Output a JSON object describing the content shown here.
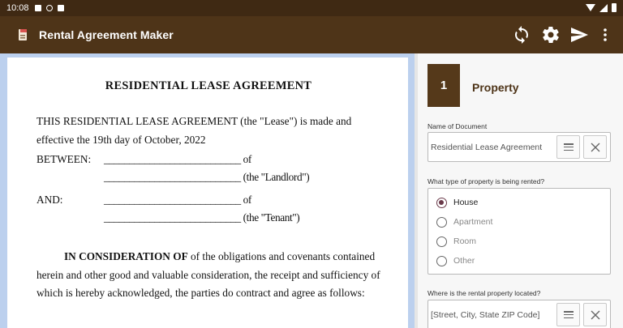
{
  "status_bar": {
    "time": "10:08",
    "icons": [
      "notification-icon",
      "debug-icon",
      "sd-card-icon",
      "wifi-icon",
      "cell-signal-icon",
      "battery-icon"
    ]
  },
  "app_bar": {
    "title": "Rental Agreement Maker",
    "background": "#4e3418",
    "actions": [
      "refresh-icon",
      "settings-icon",
      "send-icon",
      "more-vert-icon"
    ]
  },
  "document": {
    "title": "RESIDENTIAL LEASE AGREEMENT",
    "intro": "THIS RESIDENTIAL LEASE AGREEMENT (the \"Lease\") is made and effective the 19th day of October, 2022",
    "between_label": "BETWEEN:",
    "between_line1": "___________________________ of",
    "between_line2": "___________________________ (the \"Landlord\")",
    "and_label": "AND:",
    "and_line1": "___________________________ of",
    "and_line2": "___________________________ (the \"Tenant\")",
    "consideration_bold": "IN CONSIDERATION OF",
    "consideration_text": " of the obligations and covenants contained herein and other good and valuable consideration, the receipt and sufficiency of which is hereby acknowledged, the parties do contract and agree as follows:"
  },
  "panel": {
    "step_number": "1",
    "step_title": "Property",
    "doc_name": {
      "label": "Name of Document",
      "value": "Residential Lease Agreement"
    },
    "property_type": {
      "label": "What type of property is being rented?",
      "options": [
        "House",
        "Apartment",
        "Room",
        "Other"
      ],
      "selected": "House"
    },
    "location": {
      "label": "Where is the rental property located?",
      "placeholder": "[Street, City, State ZIP Code]"
    }
  },
  "colors": {
    "status_bar": "#3f2913",
    "accent": "#55391a",
    "doc_background": "#bcd0ee",
    "radio_checked": "#6a3a4a"
  }
}
